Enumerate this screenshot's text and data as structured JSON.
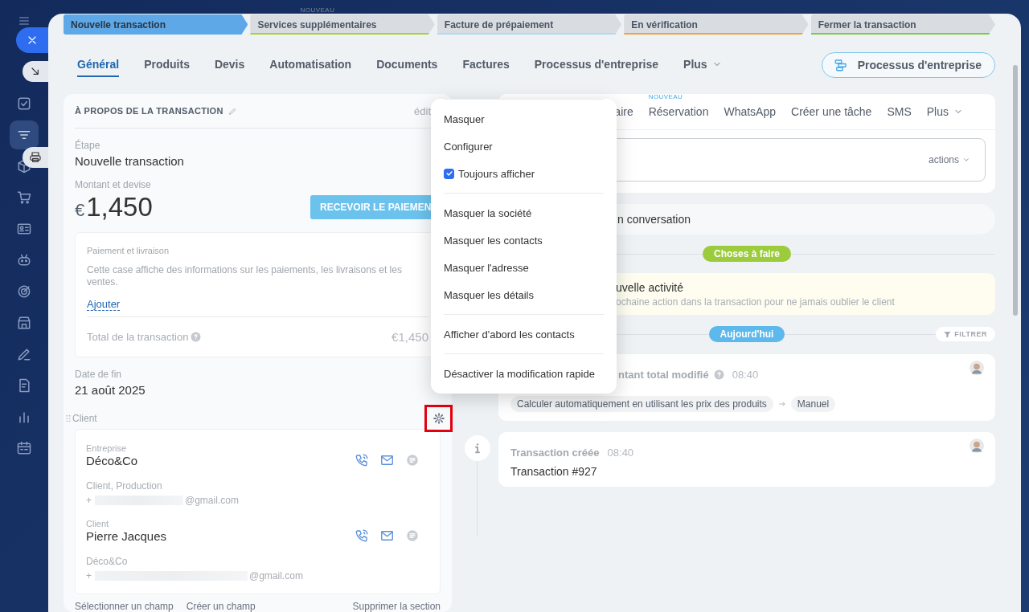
{
  "sidebar": {
    "items": [
      {
        "selected": false
      },
      {
        "selected": true
      },
      {
        "selected": false
      },
      {
        "selected": false
      },
      {
        "selected": false
      },
      {
        "selected": false
      },
      {
        "selected": false
      },
      {
        "selected": false
      },
      {
        "selected": false
      },
      {
        "selected": false
      },
      {
        "selected": false
      },
      {
        "selected": false
      }
    ]
  },
  "stages": [
    {
      "label": "Nouvelle transaction",
      "selected": true,
      "color": "#5ea8e8"
    },
    {
      "label": "Services supplémentaires",
      "selected": false,
      "color": "#a8d22f",
      "badge": "NOUVEAU"
    },
    {
      "label": "Facture de prépaiement",
      "selected": false,
      "color": "#a9dcf5"
    },
    {
      "label": "En vérification",
      "selected": false,
      "color": "#f2a33a"
    },
    {
      "label": "Fermer la transaction",
      "selected": false,
      "color": "#7ccb45"
    }
  ],
  "tabs": [
    {
      "label": "Général",
      "selected": true,
      "kind": "tab"
    },
    {
      "label": "Produits",
      "selected": false,
      "kind": "tab"
    },
    {
      "label": "Devis",
      "selected": false,
      "kind": "tab"
    },
    {
      "label": "Automatisation",
      "selected": false,
      "kind": "tab"
    },
    {
      "label": "Documents",
      "selected": false,
      "kind": "tab"
    },
    {
      "label": "Factures",
      "selected": false,
      "kind": "tab"
    },
    {
      "label": "Processus d'entreprise",
      "selected": false,
      "kind": "tab"
    },
    {
      "label": "Plus",
      "selected": false,
      "kind": "more"
    }
  ],
  "header_button": "Processus d'entreprise",
  "about": {
    "title": "À PROPOS DE LA TRANSACTION",
    "edit_link": "édit",
    "stage": {
      "label": "Étape",
      "value": "Nouvelle transaction"
    },
    "amount": {
      "label": "Montant et devise",
      "currency": "€",
      "value": "1,450",
      "pay_button": "RECEVOIR LE PAIEMEN"
    },
    "payment": {
      "title": "Paiement et livraison",
      "description": "Cette case affiche des informations sur les paiements, les livraisons et les ventes.",
      "link": "Ajouter",
      "total_label": "Total de la transaction",
      "total": "€1,450"
    },
    "end_date": {
      "label": "Date de fin",
      "value": "21 août 2025"
    },
    "client": {
      "label": "Client",
      "settings_highlighted": true,
      "contacts": [
        {
          "role": "Entreprise",
          "name": "Déco&Co",
          "detail": "Client, Production",
          "phone": "+",
          "email": "@gmail.com"
        },
        {
          "role": "Client",
          "name": "Pierre Jacques",
          "detail": "Déco&Co",
          "phone": "+",
          "email": "@gmail.com"
        }
      ]
    },
    "footer_links": [
      "Sélectionner un champ",
      "Créer un champ",
      "Supprimer la section"
    ]
  },
  "activity": {
    "tabs": [
      {
        "label": "aire",
        "kind": "tab"
      },
      {
        "label": "Réservation",
        "kind": "tab",
        "badge": "NOUVEAU"
      },
      {
        "label": "WhatsApp",
        "kind": "tab"
      },
      {
        "label": "Créer une tâche",
        "kind": "tab"
      },
      {
        "label": "SMS",
        "kind": "tab"
      },
      {
        "label": "Plus",
        "kind": "more"
      }
    ],
    "actions": "actions",
    "conversation": "n conversation"
  },
  "todo": {
    "label": "Choses à faire",
    "title": "uvelle activité",
    "description": "ochaine action dans la transaction pour ne jamais oublier le client"
  },
  "today": {
    "label": "Aujourd'hui",
    "filter": "FILTRER"
  },
  "events": [
    {
      "kind": "change",
      "title": "ntant total modifié",
      "time": "08:40",
      "chips": [
        "Calculer automatiquement en utilisant les prix des produits",
        "Manuel"
      ]
    },
    {
      "kind": "info",
      "title": "Transaction créée",
      "time": "08:40",
      "text": "Transaction #927"
    }
  ],
  "menu": {
    "groups": [
      [
        {
          "label": "Masquer",
          "kind": "item"
        },
        {
          "label": "Configurer",
          "kind": "item"
        },
        {
          "label": "Toujours afficher",
          "kind": "checkbox",
          "checked": true
        }
      ],
      [
        {
          "label": "Masquer la société",
          "kind": "item"
        },
        {
          "label": "Masquer les contacts",
          "kind": "item"
        },
        {
          "label": "Masquer l'adresse",
          "kind": "item"
        },
        {
          "label": "Masquer les détails",
          "kind": "item"
        }
      ],
      [
        {
          "label": "Afficher d'abord les contacts",
          "kind": "item"
        }
      ],
      [
        {
          "label": "Désactiver la modification rapide",
          "kind": "item"
        }
      ]
    ]
  }
}
